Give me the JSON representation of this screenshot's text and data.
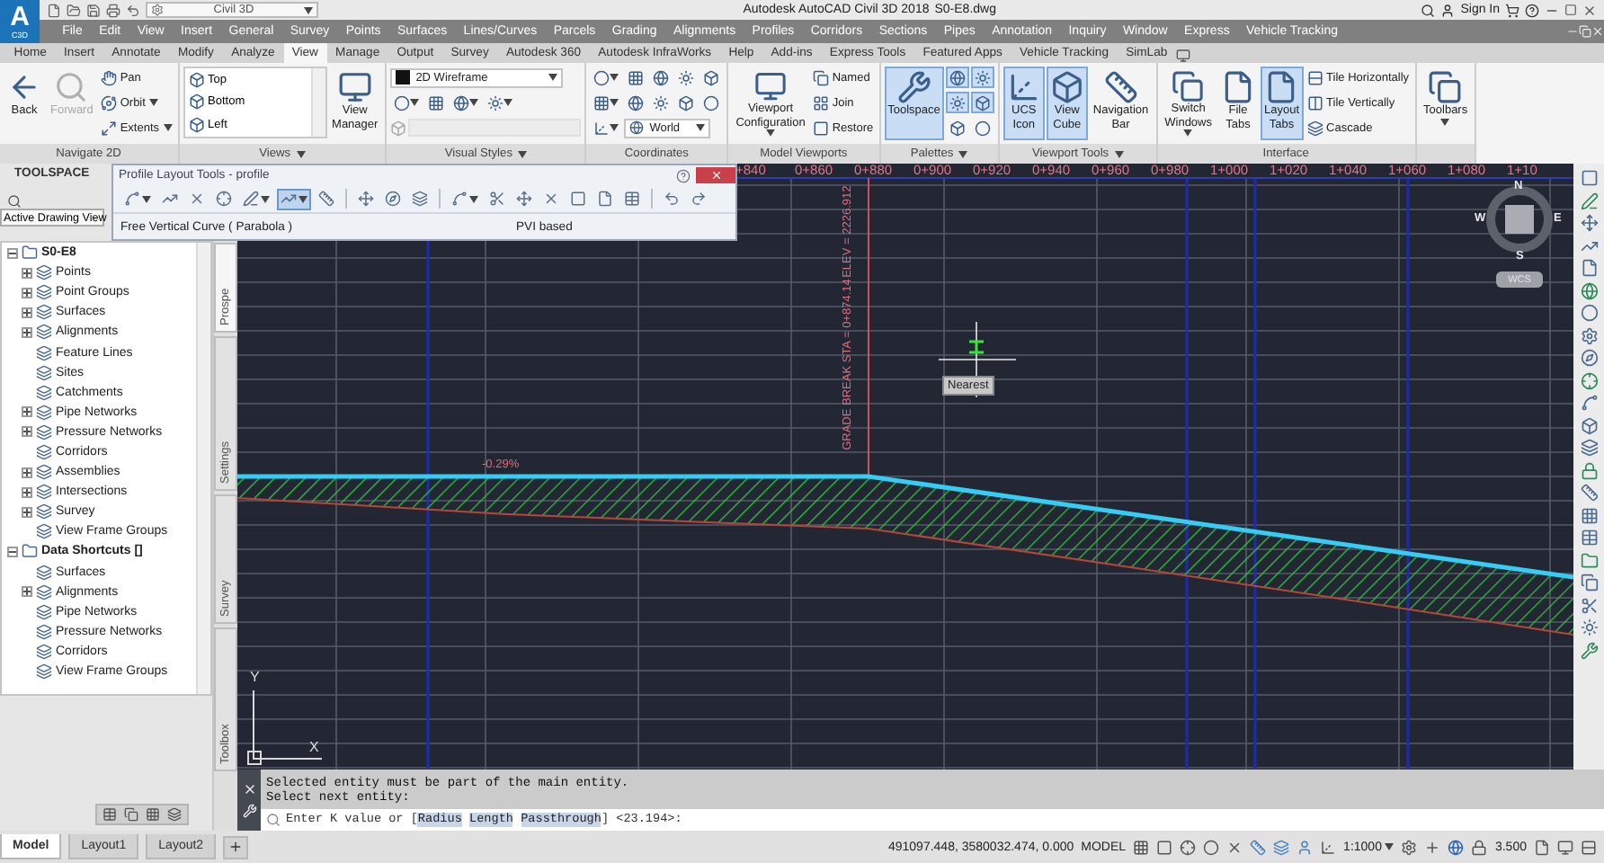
{
  "title_bar": {
    "logo": "A",
    "logo_caption": "C3D",
    "workspace": "Civil 3D",
    "title": "Autodesk AutoCAD Civil 3D 2018",
    "file": "S0-E8.dwg",
    "sign_in": "Sign In"
  },
  "menu_bar": [
    "File",
    "Edit",
    "View",
    "Insert",
    "General",
    "Survey",
    "Points",
    "Surfaces",
    "Lines/Curves",
    "Parcels",
    "Grading",
    "Alignments",
    "Profiles",
    "Corridors",
    "Sections",
    "Pipes",
    "Annotation",
    "Inquiry",
    "Window",
    "Express",
    "Vehicle Tracking"
  ],
  "ribbon_tabs": [
    {
      "label": "Home",
      "selected": false
    },
    {
      "label": "Insert",
      "selected": false
    },
    {
      "label": "Annotate",
      "selected": false
    },
    {
      "label": "Modify",
      "selected": false
    },
    {
      "label": "Analyze",
      "selected": false
    },
    {
      "label": "View",
      "selected": true
    },
    {
      "label": "Manage",
      "selected": false
    },
    {
      "label": "Output",
      "selected": false
    },
    {
      "label": "Survey",
      "selected": false
    },
    {
      "label": "Autodesk 360",
      "selected": false
    },
    {
      "label": "Autodesk InfraWorks",
      "selected": false
    },
    {
      "label": "Help",
      "selected": false
    },
    {
      "label": "Add-ins",
      "selected": false
    },
    {
      "label": "Express Tools",
      "selected": false
    },
    {
      "label": "Featured Apps",
      "selected": false
    },
    {
      "label": "Vehicle Tracking",
      "selected": false
    },
    {
      "label": "SimLab",
      "selected": false
    }
  ],
  "ribbon_panels": [
    {
      "title": "Navigate 2D",
      "has_menu": false,
      "columns": [
        [
          {
            "kind": "large",
            "label": [
              "Back"
            ],
            "selected": false,
            "disabled": false,
            "menu": false
          }
        ],
        [
          {
            "kind": "large",
            "label": [
              "Forward"
            ],
            "selected": false,
            "disabled": true,
            "menu": false
          }
        ],
        [
          {
            "kind": "small",
            "label": "Pan",
            "menu": false
          },
          {
            "kind": "small",
            "label": "Orbit",
            "menu": true
          },
          {
            "kind": "small",
            "label": "Extents",
            "menu": true
          }
        ]
      ]
    },
    {
      "title": "Views",
      "has_menu": true,
      "columns": [
        [
          {
            "kind": "list",
            "entries": [
              "Top",
              "Bottom",
              "Left"
            ]
          }
        ],
        [
          {
            "kind": "large",
            "label": [
              "View",
              "Manager"
            ],
            "selected": false,
            "menu": false
          }
        ]
      ]
    },
    {
      "title": "Visual Styles",
      "has_menu": true,
      "columns": [
        [
          {
            "kind": "dropdown",
            "value": "2D Wireframe"
          },
          {
            "kind": "icons",
            "icons": [
              {
                "menu": true,
                "selected": false
              },
              {
                "menu": false,
                "selected": false
              },
              {
                "menu": true,
                "selected": false
              },
              {
                "menu": true,
                "selected": false
              }
            ]
          },
          {
            "kind": "field",
            "disabled": true
          }
        ]
      ]
    },
    {
      "title": "Coordinates",
      "has_menu": false,
      "columns": [
        [
          {
            "kind": "icons",
            "icons": [
              {
                "menu": true,
                "selected": false
              },
              {
                "menu": false,
                "selected": false
              },
              {
                "menu": false,
                "selected": false
              },
              {
                "menu": false,
                "selected": false
              },
              {
                "menu": false,
                "selected": false
              }
            ]
          },
          {
            "kind": "icons",
            "icons": [
              {
                "menu": true,
                "selected": false
              },
              {
                "menu": false,
                "selected": false
              },
              {
                "menu": false,
                "selected": false
              },
              {
                "menu": false,
                "selected": false
              },
              {
                "menu": false,
                "selected": false
              }
            ]
          },
          {
            "kind": "dropdown",
            "value": "World"
          }
        ]
      ]
    },
    {
      "title": "Model Viewports",
      "has_menu": false,
      "columns": [
        [
          {
            "kind": "large",
            "label": [
              "Viewport",
              "Configuration"
            ],
            "selected": false,
            "menu": true
          }
        ],
        [
          {
            "kind": "small",
            "label": "Named",
            "menu": false
          },
          {
            "kind": "small",
            "label": "Join",
            "menu": false
          },
          {
            "kind": "small",
            "label": "Restore",
            "menu": false
          }
        ]
      ]
    },
    {
      "title": "Palettes",
      "has_menu": true,
      "columns": [
        [
          {
            "kind": "large",
            "label": [
              "Toolspace"
            ],
            "selected": true,
            "menu": false
          }
        ],
        [
          {
            "kind": "icons",
            "icons": [
              {
                "menu": false,
                "selected": true
              },
              {
                "menu": false,
                "selected": true
              }
            ]
          },
          {
            "kind": "icons",
            "icons": [
              {
                "menu": false,
                "selected": true
              },
              {
                "menu": false,
                "selected": true
              }
            ]
          },
          {
            "kind": "icons",
            "icons": [
              {
                "menu": false,
                "selected": false
              },
              {
                "menu": false,
                "selected": false
              }
            ]
          }
        ]
      ]
    },
    {
      "title": "Viewport Tools",
      "has_menu": true,
      "columns": [
        [
          {
            "kind": "large",
            "label": [
              "UCS",
              "Icon"
            ],
            "selected": true,
            "menu": false
          }
        ],
        [
          {
            "kind": "large",
            "label": [
              "View",
              "Cube"
            ],
            "selected": true,
            "menu": false
          }
        ],
        [
          {
            "kind": "large",
            "label": [
              "Navigation",
              "Bar"
            ],
            "selected": false,
            "menu": false
          }
        ]
      ]
    },
    {
      "title": "Interface",
      "has_menu": false,
      "columns": [
        [
          {
            "kind": "large",
            "label": [
              "Switch",
              "Windows"
            ],
            "selected": false,
            "menu": true
          }
        ],
        [
          {
            "kind": "large",
            "label": [
              "File",
              "Tabs"
            ],
            "selected": false,
            "menu": false
          }
        ],
        [
          {
            "kind": "large",
            "label": [
              "Layout",
              "Tabs"
            ],
            "selected": true,
            "menu": false
          }
        ],
        [
          {
            "kind": "small",
            "label": "Tile Horizontally",
            "menu": false
          },
          {
            "kind": "small",
            "label": "Tile Vertically",
            "menu": false
          },
          {
            "kind": "small",
            "label": "Cascade",
            "menu": false
          }
        ]
      ]
    },
    {
      "columns": [
        [
          {
            "kind": "large",
            "label": [
              "Toolbars"
            ],
            "selected": false,
            "menu": true
          }
        ]
      ]
    }
  ],
  "toolspace": {
    "title": "TOOLSPACE",
    "view": "Active Drawing View",
    "tree": [
      {
        "label": "S0-E8",
        "expanded": true,
        "children": [
          {
            "label": "Points",
            "expanded": false
          },
          {
            "label": "Point Groups",
            "expanded": false
          },
          {
            "label": "Surfaces",
            "expanded": false
          },
          {
            "label": "Alignments",
            "expanded": false
          },
          {
            "label": "Feature Lines"
          },
          {
            "label": "Sites"
          },
          {
            "label": "Catchments"
          },
          {
            "label": "Pipe Networks",
            "expanded": false
          },
          {
            "label": "Pressure Networks",
            "expanded": false
          },
          {
            "label": "Corridors"
          },
          {
            "label": "Assemblies",
            "expanded": false
          },
          {
            "label": "Intersections",
            "expanded": false
          },
          {
            "label": "Survey",
            "expanded": false
          },
          {
            "label": "View Frame Groups"
          }
        ]
      },
      {
        "label": "Data Shortcuts []",
        "expanded": true,
        "children": [
          {
            "label": "Surfaces"
          },
          {
            "label": "Alignments",
            "expanded": false
          },
          {
            "label": "Pipe Networks"
          },
          {
            "label": "Pressure Networks"
          },
          {
            "label": "Corridors"
          },
          {
            "label": "View Frame Groups"
          }
        ]
      }
    ],
    "side_tabs": [
      {
        "label": "Prospe",
        "selected": true
      },
      {
        "label": "Settings",
        "selected": false
      },
      {
        "label": "Survey",
        "selected": false
      },
      {
        "label": "Toolbox",
        "selected": false
      }
    ]
  },
  "profile_tools": {
    "title": "Profile Layout Tools - profile",
    "tools": [
      {
        "kind": "tool",
        "menu": true,
        "selected": false
      },
      {
        "kind": "tool",
        "menu": false,
        "selected": false
      },
      {
        "kind": "tool",
        "menu": false,
        "selected": false
      },
      {
        "kind": "tool",
        "menu": false,
        "selected": false
      },
      {
        "kind": "tool",
        "menu": true,
        "selected": false
      },
      {
        "kind": "tool",
        "menu": true,
        "selected": true
      },
      {
        "kind": "tool",
        "menu": false,
        "selected": false
      },
      {
        "kind": "separator"
      },
      {
        "kind": "tool",
        "menu": false,
        "selected": false
      },
      {
        "kind": "tool",
        "menu": false,
        "selected": false
      },
      {
        "kind": "tool",
        "menu": false,
        "selected": false
      },
      {
        "kind": "separator"
      },
      {
        "kind": "tool",
        "menu": true,
        "selected": false
      },
      {
        "kind": "tool",
        "menu": false,
        "selected": false
      },
      {
        "kind": "tool",
        "menu": false,
        "selected": false
      },
      {
        "kind": "tool",
        "menu": false,
        "selected": false
      },
      {
        "kind": "tool",
        "menu": false,
        "selected": false
      },
      {
        "kind": "tool",
        "menu": false,
        "selected": false
      },
      {
        "kind": "tool",
        "menu": false,
        "selected": false
      },
      {
        "kind": "separator"
      },
      {
        "kind": "tool",
        "menu": false,
        "selected": false
      },
      {
        "kind": "tool",
        "menu": false,
        "selected": false
      }
    ],
    "mode": "Free Vertical Curve ( Parabola )",
    "basis": "PVI based"
  },
  "drawing": {
    "stations": [
      "+840",
      "0+860",
      "0+880",
      "0+900",
      "0+920",
      "0+940",
      "0+960",
      "0+980",
      "1+000",
      "1+020",
      "1+040",
      "1+060",
      "1+080",
      "1+10"
    ],
    "grade_break": {
      "station": "GRADE BREAK STA = 0+874.14",
      "elevation": "ELEV = 2226.912"
    },
    "grade": "-0.29%",
    "snap_tooltip": "Nearest",
    "viewcube": {
      "north": "N",
      "south": "S",
      "east": "E",
      "west": "W",
      "ucs": "WCS"
    },
    "ucs": {
      "x": "X",
      "y": "Y"
    }
  },
  "command_line": {
    "history": [
      "Selected entity must be part of the main entity.",
      "Select next entity:"
    ],
    "prompt": {
      "text": "Enter K value or [",
      "options": [
        "Radius",
        "Length",
        "Passthrough"
      ],
      "suffix": "] <23.194>:"
    }
  },
  "layout_tabs": [
    {
      "label": "Model",
      "selected": true
    },
    {
      "label": "Layout1",
      "selected": false
    },
    {
      "label": "Layout2",
      "selected": false
    }
  ],
  "status_bar": {
    "coordinates": "491097.448, 3580032.474, 0.000",
    "space": "MODEL",
    "scale": "1:1000",
    "annotation_value": "3.500"
  }
}
